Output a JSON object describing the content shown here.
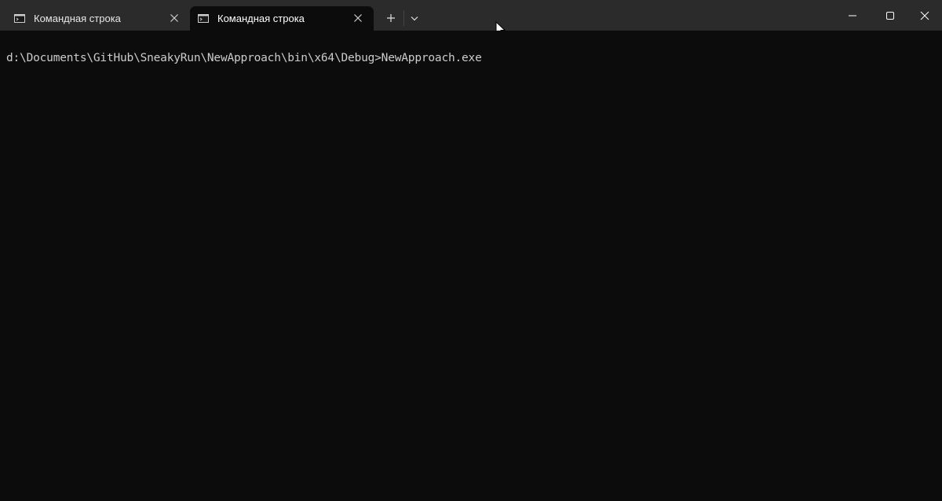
{
  "tabs": [
    {
      "label": "Командная строка",
      "active": false,
      "icon": "terminal-icon"
    },
    {
      "label": "Командная строка",
      "active": true,
      "icon": "terminal-icon"
    }
  ],
  "toolbar": {
    "new_tab_icon": "plus-icon",
    "dropdown_icon": "chevron-down-icon"
  },
  "caption": {
    "minimize_icon": "minimize-icon",
    "maximize_icon": "maximize-icon",
    "close_icon": "close-icon"
  },
  "terminal": {
    "prompt": "d:\\Documents\\GitHub\\SneakyRun\\NewApproach\\bin\\x64\\Debug>",
    "command": "NewApproach.exe"
  },
  "colors": {
    "titlebar_bg": "#2b2b2b",
    "terminal_bg": "#0c0c0c",
    "terminal_text": "#cccccc"
  }
}
